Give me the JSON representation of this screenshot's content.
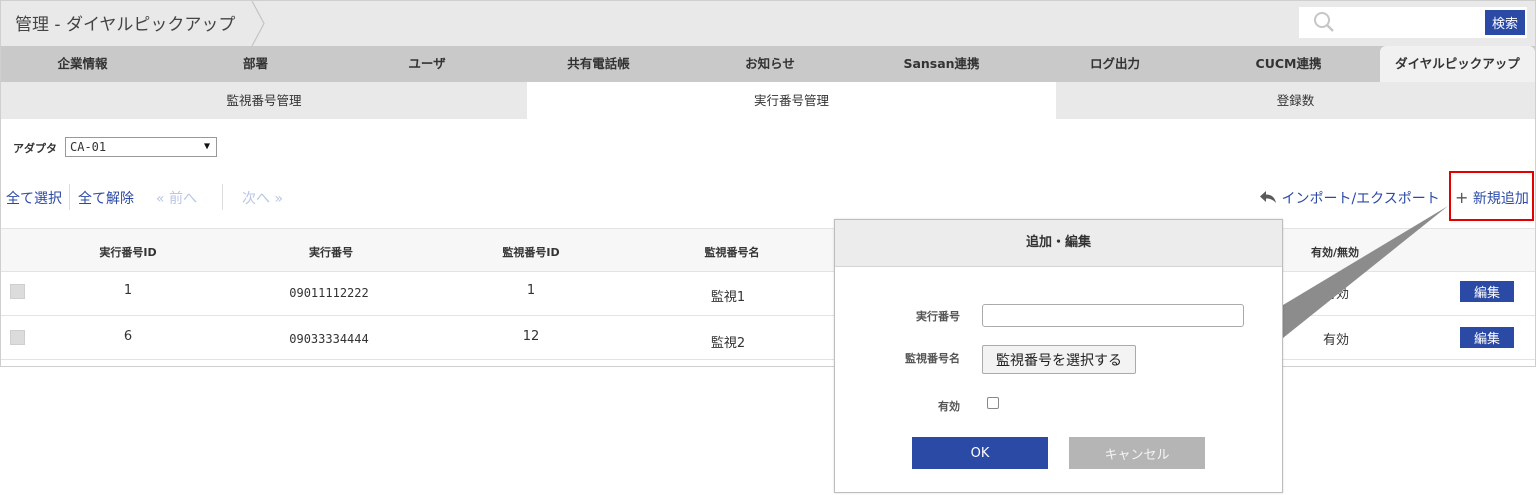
{
  "header": {
    "breadcrumb": "管理 - ダイヤルピックアップ",
    "search": {
      "placeholder": "",
      "value": "",
      "button_label": "検索"
    }
  },
  "main_tabs": [
    {
      "label": "企業情報"
    },
    {
      "label": "部署"
    },
    {
      "label": "ユーザ"
    },
    {
      "label": "共有電話帳"
    },
    {
      "label": "お知らせ"
    },
    {
      "label": "Sansan連携"
    },
    {
      "label": "ログ出力"
    },
    {
      "label": "CUCM連携"
    },
    {
      "label": "ダイヤルピックアップ",
      "active": true
    }
  ],
  "sub_tabs": [
    {
      "label": "監視番号管理"
    },
    {
      "label": "実行番号管理",
      "active": true
    },
    {
      "label": "登録数"
    }
  ],
  "adapter": {
    "label": "アダプタ",
    "selected": "CA-01"
  },
  "toolbar": {
    "select_all": "全て選択",
    "deselect_all": "全て解除",
    "prev": "前へ",
    "next": "次へ",
    "import_export": "インポート/エクスポート",
    "add_new": "新規追加"
  },
  "table": {
    "columns": [
      "実行番号ID",
      "実行番号",
      "監視番号ID",
      "監視番号名",
      "有効/無効"
    ],
    "rows": [
      {
        "exec_id": "1",
        "exec_number": "09011112222",
        "monitor_id": "1",
        "monitor_name": "監視1",
        "status": "有効",
        "edit_label": "編集"
      },
      {
        "exec_id": "6",
        "exec_number": "09033334444",
        "monitor_id": "12",
        "monitor_name": "監視2",
        "status": "有効",
        "edit_label": "編集"
      }
    ]
  },
  "dialog": {
    "title": "追加・編集",
    "exec_number_label": "実行番号",
    "exec_number_value": "",
    "monitor_name_label": "監視番号名",
    "select_monitor_button": "監視番号を選択する",
    "enabled_label": "有効",
    "enabled_checked": false,
    "ok_label": "OK",
    "cancel_label": "キャンセル"
  },
  "colors": {
    "primary": "#2b4aa6",
    "highlight": "#e30000",
    "tab_bar": "#c9c9c9",
    "header_bg": "#e9e9e9"
  }
}
